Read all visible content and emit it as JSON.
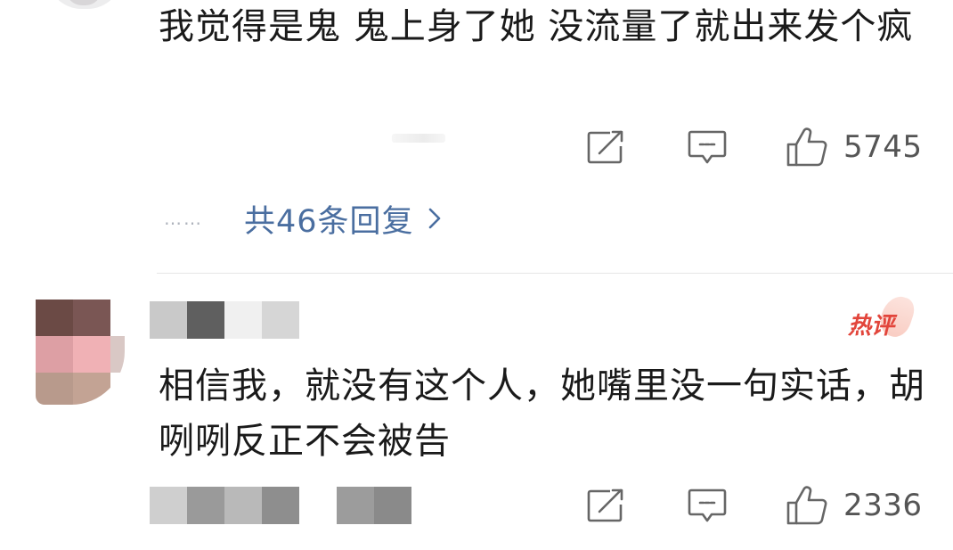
{
  "comment_1": {
    "text": "我觉得是鬼  鬼上身了她 没流量了就出来发个疯",
    "like_count": "5745"
  },
  "replies_link": {
    "dots": "……",
    "label": "共46条回复"
  },
  "comment_2": {
    "hot_badge": "热评",
    "text": "相信我，就没有这个人，她嘴里没一句实话，胡咧咧反正不会被告",
    "like_count": "2336"
  },
  "icons": {
    "share": "share-icon",
    "reply": "comment-icon",
    "like": "thumbs-up-icon",
    "chevron": "chevron-right-icon"
  },
  "colors": {
    "link": "#4a6ea0",
    "hot_badge": "#e2453b",
    "icon_stroke": "#666666",
    "count_text": "#555555"
  }
}
